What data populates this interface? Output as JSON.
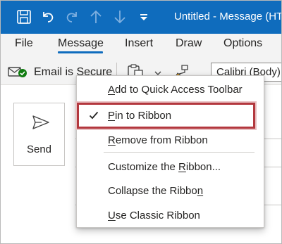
{
  "window": {
    "title": "Untitled  -  Message (HT"
  },
  "quick_access": {
    "icons": [
      "save-icon",
      "undo-icon",
      "redo-icon",
      "up-arrow-icon",
      "down-arrow-icon",
      "customize-qat-icon"
    ]
  },
  "tabs": [
    {
      "label": "File",
      "active": false
    },
    {
      "label": "Message",
      "active": true
    },
    {
      "label": "Insert",
      "active": false
    },
    {
      "label": "Draw",
      "active": false
    },
    {
      "label": "Options",
      "active": false
    }
  ],
  "ribbon": {
    "secure_label": "Email is Secure",
    "font_value": "Calibri (Body)"
  },
  "compose": {
    "send_label": "Send"
  },
  "context_menu": {
    "items": [
      {
        "pre": "",
        "u": "A",
        "post": "dd to Quick Access Toolbar",
        "checked": false
      },
      {
        "pre": "",
        "u": "P",
        "post": "in to Ribbon",
        "checked": true
      },
      {
        "pre": "",
        "u": "R",
        "post": "emove from Ribbon",
        "checked": false
      },
      {
        "pre": "Customize the ",
        "u": "R",
        "post": "ibbon...",
        "checked": false
      },
      {
        "pre": "Collapse the Ribbo",
        "u": "n",
        "post": "",
        "checked": false
      },
      {
        "pre": "",
        "u": "U",
        "post": "se Classic Ribbon",
        "checked": false
      }
    ],
    "highlighted_item": "Pin to Ribbon"
  },
  "colors": {
    "title_bar": "#0f6cbd",
    "tab_row": "#f3f3f3",
    "highlight_border": "#b3383e"
  }
}
